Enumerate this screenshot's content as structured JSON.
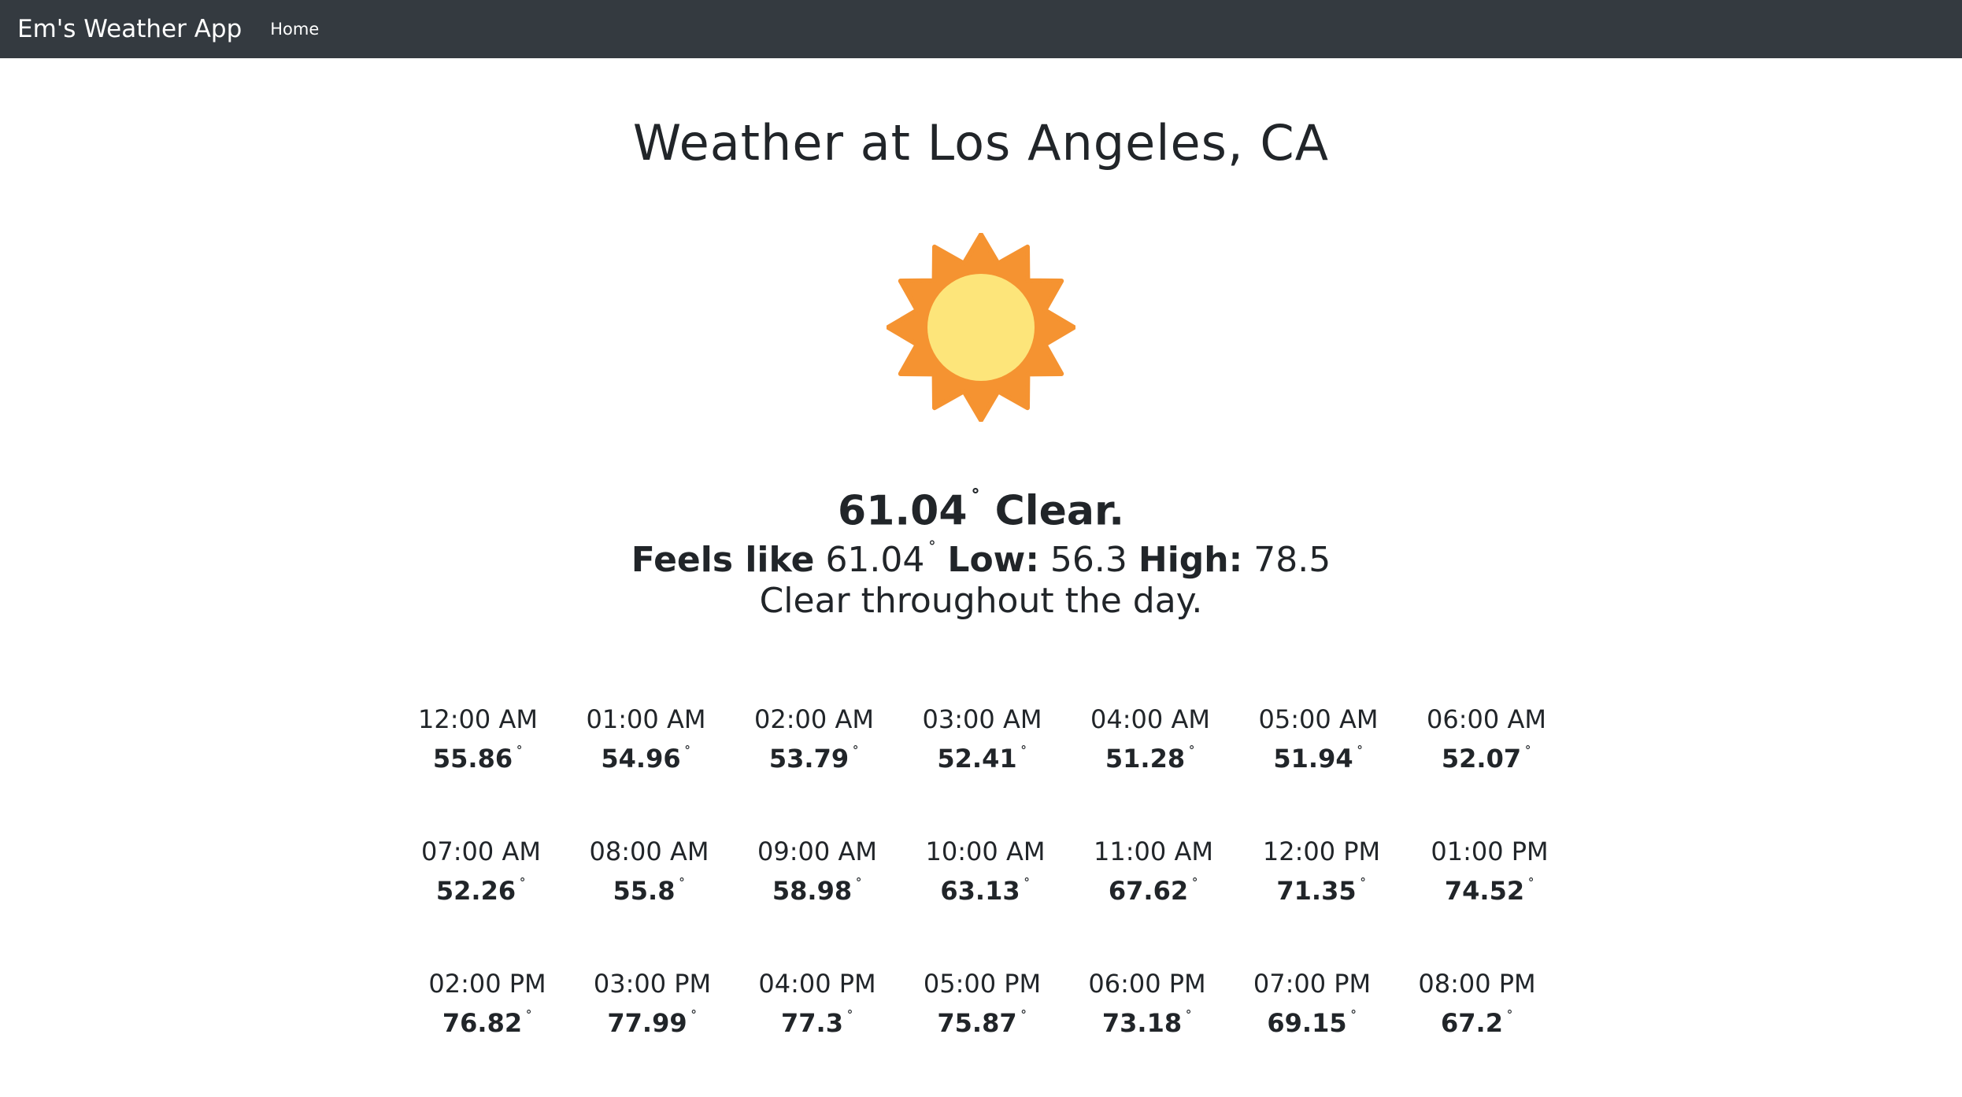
{
  "navbar": {
    "brand": "Em's Weather App",
    "home_link": "Home"
  },
  "title": "Weather at Los Angeles, CA",
  "icon": "sun-icon",
  "colors": {
    "navbar_bg": "#343a40",
    "sun_rays": "#f59331",
    "sun_core": "#fde57a"
  },
  "current": {
    "temp": "61.04",
    "condition": "Clear.",
    "feels_like_label": "Feels like",
    "feels_like": "61.04",
    "low_label": "Low:",
    "low": "56.3",
    "high_label": "High:",
    "high": "78.5",
    "daily_summary": "Clear throughout the day."
  },
  "degree_symbol": "˚",
  "hourly": [
    {
      "time": "12:00 AM",
      "temp": "55.86"
    },
    {
      "time": "01:00 AM",
      "temp": "54.96"
    },
    {
      "time": "02:00 AM",
      "temp": "53.79"
    },
    {
      "time": "03:00 AM",
      "temp": "52.41"
    },
    {
      "time": "04:00 AM",
      "temp": "51.28"
    },
    {
      "time": "05:00 AM",
      "temp": "51.94"
    },
    {
      "time": "06:00 AM",
      "temp": "52.07"
    },
    {
      "time": "07:00 AM",
      "temp": "52.26"
    },
    {
      "time": "08:00 AM",
      "temp": "55.8"
    },
    {
      "time": "09:00 AM",
      "temp": "58.98"
    },
    {
      "time": "10:00 AM",
      "temp": "63.13"
    },
    {
      "time": "11:00 AM",
      "temp": "67.62"
    },
    {
      "time": "12:00 PM",
      "temp": "71.35"
    },
    {
      "time": "01:00 PM",
      "temp": "74.52"
    },
    {
      "time": "02:00 PM",
      "temp": "76.82"
    },
    {
      "time": "03:00 PM",
      "temp": "77.99"
    },
    {
      "time": "04:00 PM",
      "temp": "77.3"
    },
    {
      "time": "05:00 PM",
      "temp": "75.87"
    },
    {
      "time": "06:00 PM",
      "temp": "73.18"
    },
    {
      "time": "07:00 PM",
      "temp": "69.15"
    },
    {
      "time": "08:00 PM",
      "temp": "67.2"
    }
  ]
}
